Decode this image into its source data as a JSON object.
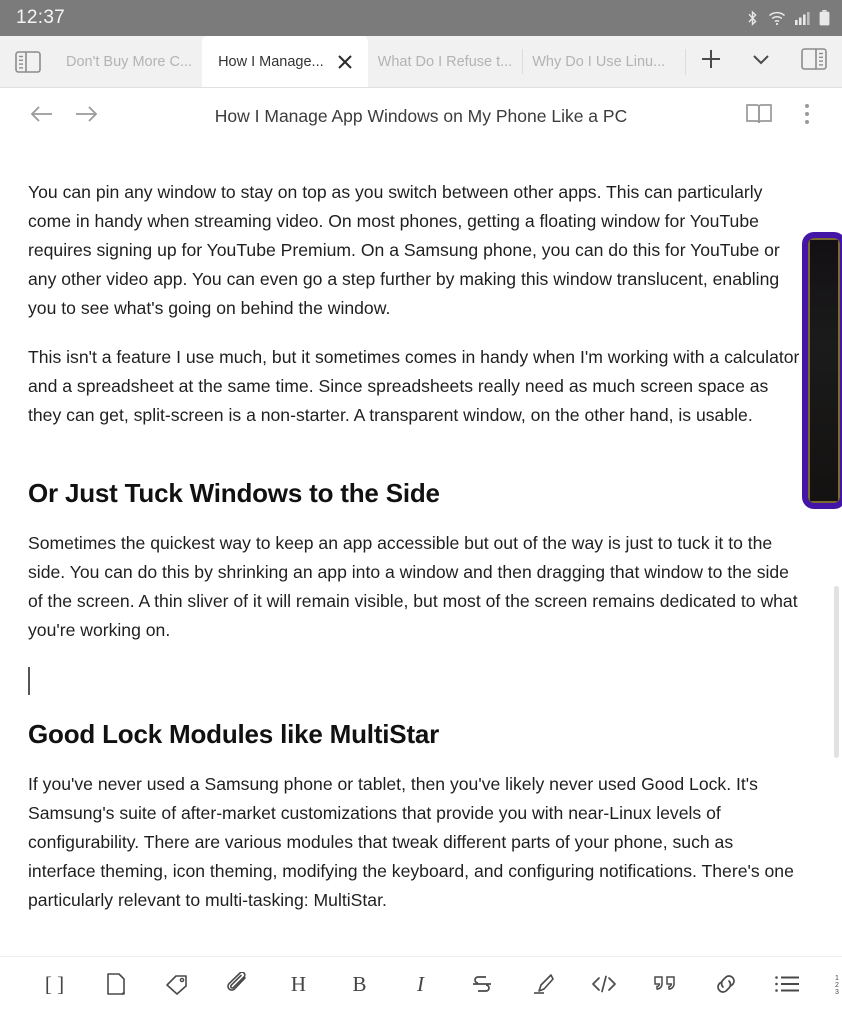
{
  "status_bar": {
    "time": "12:37",
    "icons": [
      "bluetooth-icon",
      "wifi-icon",
      "cellular-signal-icon",
      "battery-icon"
    ],
    "background": "#7b7b7b"
  },
  "tab_strip": {
    "left_panel_toggle": "left-panel-toggle-icon",
    "right_panel_toggle": "right-panel-toggle-icon",
    "new_tab_label": "+",
    "tab_list_chevron": "chevron-down-icon",
    "tabs": [
      {
        "label": "Don't Buy More C...",
        "active": false,
        "closable": false
      },
      {
        "label": "How I Manage...",
        "active": true,
        "closable": true,
        "close_label": "✕"
      },
      {
        "label": "What Do I Refuse t...",
        "active": false,
        "closable": false
      },
      {
        "label": "Why Do I Use Linu...",
        "active": false,
        "closable": false
      }
    ]
  },
  "nav_bar": {
    "back_icon": "arrow-left-icon",
    "forward_icon": "arrow-right-icon",
    "title": "How I Manage App Windows on My Phone Like a PC",
    "reader_icon": "book-icon",
    "menu_icon": "more-vertical-icon"
  },
  "content": {
    "clipped_top_line": "·                    ·               ·",
    "paragraph_1": "You can pin any window to stay on top as you switch between other apps. This can particularly come in handy when streaming video. On most phones, getting a floating window for YouTube requires signing up for YouTube Premium. On a Samsung phone, you can do this for YouTube or any other video app. You can even go a step further by making this window translucent, enabling you to see what's going on behind the window.",
    "paragraph_2": "This isn't a feature I use much, but it sometimes comes in handy when I'm working with a calculator and a spreadsheet at the same time. Since spreadsheets really need as much screen space as they can get, split-screen is a non-starter. A transparent window, on the other hand, is usable.",
    "heading_1": "Or Just Tuck Windows to the Side",
    "paragraph_3": "Sometimes the quickest way to keep an app accessible but out of the way is just to tuck it to the side. You can do this by shrinking an app into a window and then dragging that window to the side of the screen. A thin sliver of it will remain visible, but most of the screen remains dedicated to what you're working on.",
    "heading_2": "Good Lock Modules like MultiStar",
    "paragraph_4": "If you've never used a Samsung phone or tablet, then you've likely never used Good Lock. It's Samsung's suite of after-market customizations that provide you with near-Linux levels of configurability. There are various modules that tweak different parts of your phone, such as interface theming, icon theming, modifying the keyboard, and configuring notifications. There's one particularly relevant to multi-tasking: MultiStar.",
    "side_image_border_color": "#4416a8"
  },
  "bottom_toolbar": {
    "tools": [
      {
        "name": "brackets-icon",
        "glyph": "[ ]"
      },
      {
        "name": "page-icon",
        "glyph": ""
      },
      {
        "name": "tag-icon",
        "glyph": ""
      },
      {
        "name": "attachment-icon",
        "glyph": ""
      },
      {
        "name": "heading-icon",
        "glyph": "H"
      },
      {
        "name": "bold-icon",
        "glyph": "B"
      },
      {
        "name": "italic-icon",
        "glyph": "I"
      },
      {
        "name": "strikethrough-icon",
        "glyph": ""
      },
      {
        "name": "highlighter-icon",
        "glyph": ""
      },
      {
        "name": "code-icon",
        "glyph": "</>"
      },
      {
        "name": "quote-icon",
        "glyph": "””"
      },
      {
        "name": "link-icon",
        "glyph": ""
      },
      {
        "name": "bullet-list-icon",
        "glyph": ""
      },
      {
        "name": "numbered-list-icon",
        "glyph": ""
      }
    ]
  }
}
